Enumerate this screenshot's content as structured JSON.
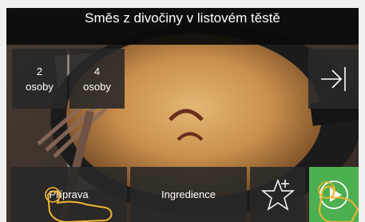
{
  "header": {
    "title": "Směs z divočiny v listovém těstě"
  },
  "servings": [
    {
      "number": "2",
      "unit": "osoby"
    },
    {
      "number": "4",
      "unit": "osoby"
    }
  ],
  "nav": {
    "next_icon": "arrow-right-to-bar-icon"
  },
  "bottom": {
    "preparation_label": "Příprava",
    "ingredients_label": "Ingredience",
    "favorite_icon": "star-add-icon",
    "start_icon": "play-icon"
  },
  "colors": {
    "start_accent": "#4caf50",
    "hint_hand": "#f2b632"
  }
}
